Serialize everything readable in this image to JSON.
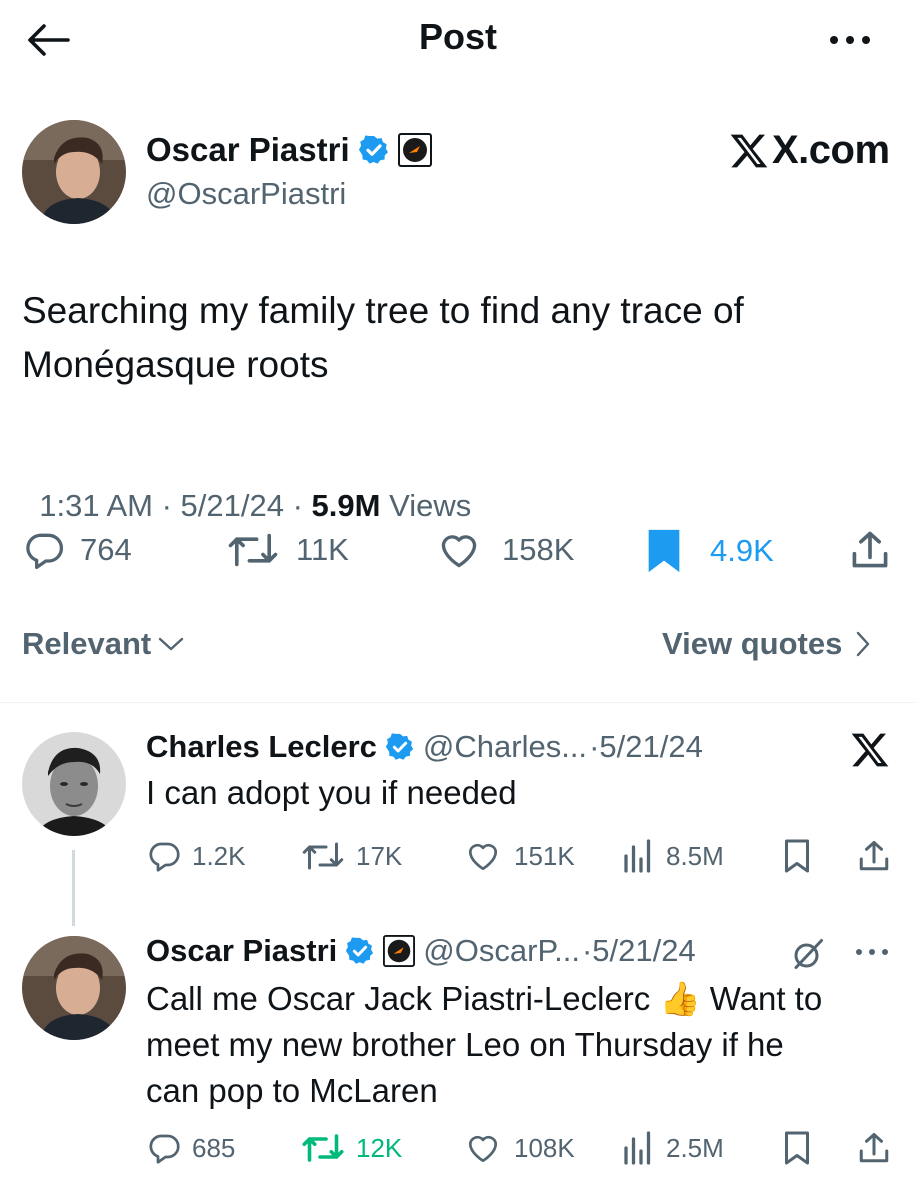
{
  "header": {
    "title": "Post",
    "back_icon": "arrow-left-icon",
    "more_icon": "more-dots-icon"
  },
  "watermark": "X.com",
  "post": {
    "author_name": "Oscar Piastri",
    "author_handle": "@OscarPiastri",
    "text_line1": "Searching my family tree to find any trace of",
    "text_line2": "Monégasque roots",
    "time": "1:31 AM",
    "sep1": " · ",
    "date": "5/21/24",
    "sep2": " · ",
    "views": "5.9M",
    "views_label": " Views",
    "replies": "764",
    "reposts": "11K",
    "likes": "158K",
    "bookmarks": "4.9K"
  },
  "sort": {
    "label": "Relevant",
    "quotes_label": "View quotes"
  },
  "replies": [
    {
      "name": "Charles Leclerc",
      "handle": "@Charles...",
      "date": "·5/21/24",
      "text": "I can adopt you if needed",
      "replies": "1.2K",
      "reposts": "17K",
      "likes": "151K",
      "views": "8.5M"
    },
    {
      "name": "Oscar Piastri",
      "handle": "@OscarP...",
      "date": "·5/21/24",
      "text_line1": "Call me Oscar Jack Piastri-Leclerc 👍 Want to",
      "text_line2": "meet my new brother Leo on Thursday if he",
      "text_line3": "can pop to McLaren",
      "replies": "685",
      "reposts": "12K",
      "likes": "108K",
      "views": "2.5M"
    }
  ],
  "colors": {
    "accent": "#1d9bf0",
    "repost_active": "#00ba7c",
    "muted": "#536471",
    "text": "#0f1419"
  }
}
